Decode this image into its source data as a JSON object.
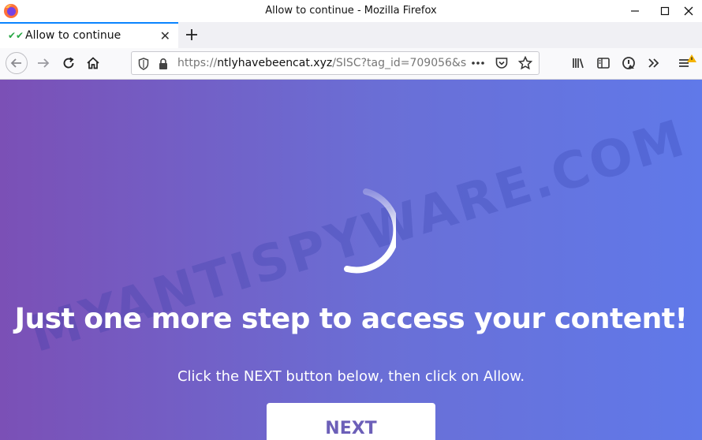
{
  "window": {
    "title": "Allow to continue - Mozilla Firefox",
    "controls": {
      "minimize": "—",
      "maximize": "☐",
      "close": "✕"
    }
  },
  "tabs": [
    {
      "label": "Allow to continue",
      "icon": "check-icon",
      "active": true
    }
  ],
  "navbar": {
    "url_scheme": "https://",
    "url_host": "ntlyhavebeencat.xyz",
    "url_path": "/SISC?tag_id=709056&s"
  },
  "page": {
    "watermark": "MYANTISPYWARE.COM",
    "headline": "Just one more step to access your content!",
    "subtext": "Click the NEXT button below, then click on Allow.",
    "next_label": "NEXT"
  },
  "colors": {
    "gradient_start": "#7b50b6",
    "gradient_end": "#6079e9",
    "accent": "#0a84ff",
    "button_text": "#6c5fb8"
  }
}
